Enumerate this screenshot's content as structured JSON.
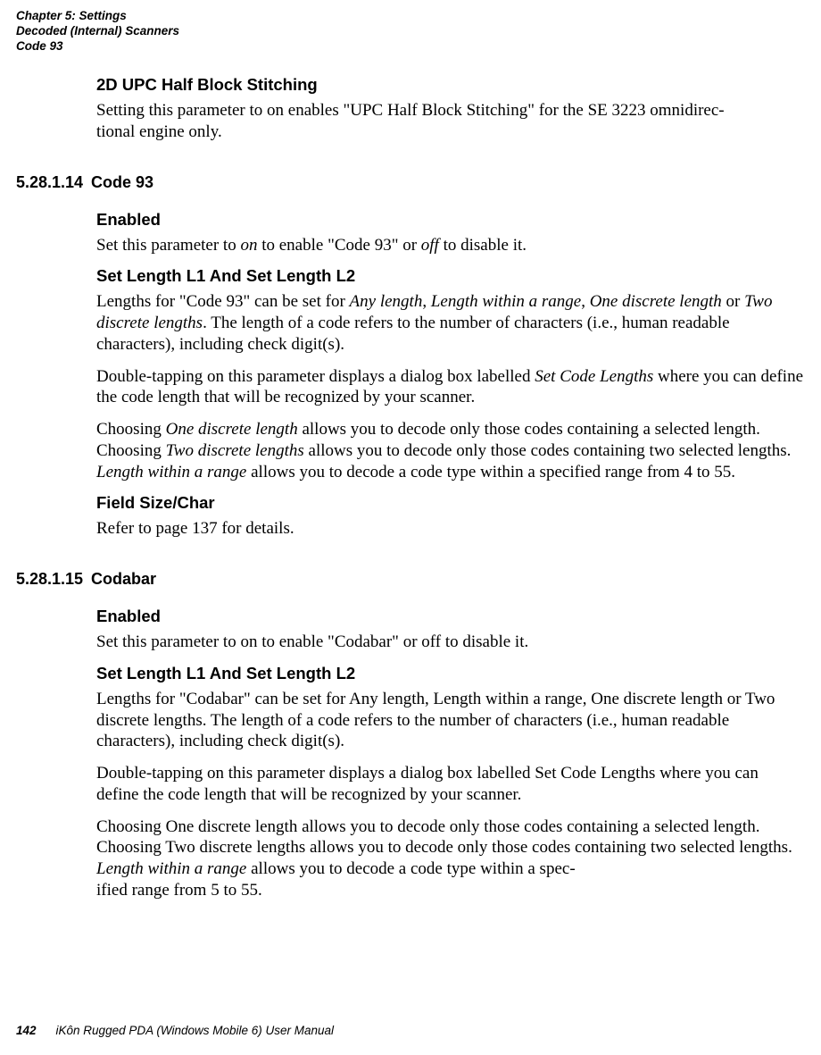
{
  "header": {
    "line1": "Chapter 5: Settings",
    "line2": "Decoded (Internal) Scanners",
    "line3": "Code 93"
  },
  "h1": {
    "title": "2D UPC Half Block Stitching",
    "p1a": "Setting this parameter to on enables \"UPC Half Block Stitching\" for the SE 3223 omnidirec-",
    "p1b": "tional engine only."
  },
  "s1": {
    "num": "5.28.1.14",
    "title": "Code 93",
    "enabled": {
      "title": "Enabled",
      "p_pre": "Set this parameter to ",
      "on": "on",
      "p_mid": " to enable \"Code 93\" or ",
      "off": "off",
      "p_post": " to disable it."
    },
    "len": {
      "title": "Set Length L1 And Set Length L2",
      "p1_a": "Lengths for \"Code 93\" can be set for ",
      "any": "Any length",
      "c1": ", ",
      "lwr": "Length within a range",
      "c2": ", ",
      "odl": "One discrete length",
      "p1_b": "or ",
      "tdl": "Two discrete lengths",
      "p1_c": ". The length of a code refers to the number of characters (i.e., human readable characters), including check digit(s).",
      "p2_a": "Double-tapping on this parameter displays a dialog box labelled ",
      "scl": "Set Code Lengths",
      "p2_b": " where you can define the code length that will be recognized by your scanner.",
      "p3_a": "Choosing ",
      "p3_b": " allows you to decode only those codes containing a selected length. Choosing ",
      "p3_c": " allows you to decode only those codes containing two selected lengths. ",
      "p3_d": " allows you to decode a code type within a specified range from 4 to 55."
    },
    "fsc": {
      "title": "Field Size/Char",
      "p": "Refer to page 137 for details."
    }
  },
  "s2": {
    "num": "5.28.1.15",
    "title": "Codabar",
    "enabled": {
      "title": "Enabled",
      "p": "Set this parameter to on to enable \"Codabar\" or off to disable it."
    },
    "len": {
      "title": "Set Length L1 And Set Length L2",
      "p1": "Lengths for \"Codabar\" can be set for Any length, Length within a range, One discrete length or Two discrete lengths. The length of a code refers to the number of characters (i.e., human readable characters), including check digit(s).",
      "p2": "Double-tapping on this parameter displays a dialog box labelled Set Code Lengths where you can define the code length that will be recognized by your scanner.",
      "p3_a": "Choosing One discrete length allows you to decode only those codes containing a selected length. Choosing Two discrete lengths allows you to decode only those codes containing two selected lengths. ",
      "lwr": "Length within a range",
      "p3_b": " allows you to decode a code type within a spec-",
      "p3_c": "ified range from 5 to 55."
    }
  },
  "footer": {
    "page": "142",
    "title": "iKôn Rugged PDA (Windows Mobile 6) User Manual"
  }
}
